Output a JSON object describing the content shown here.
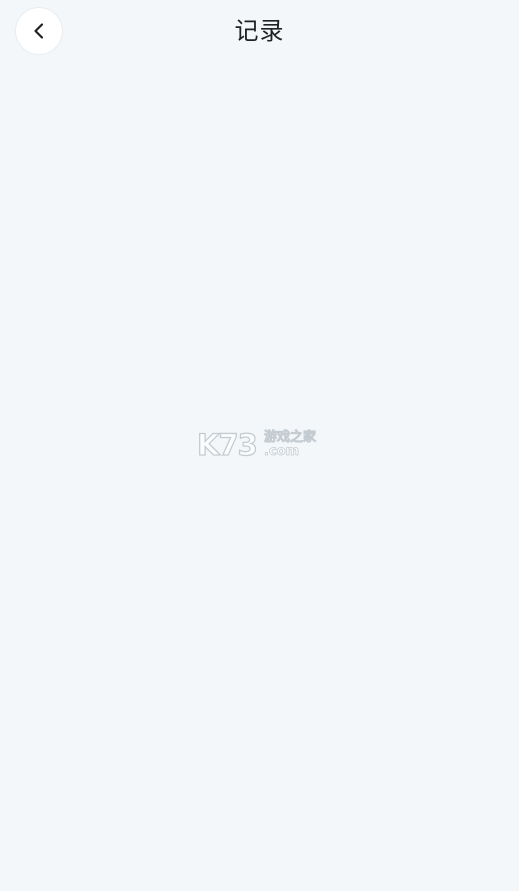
{
  "header": {
    "title": "记录",
    "back_icon": "chevron-left-icon"
  },
  "watermark": {
    "brand": "K73",
    "subtitle": "游戏之家",
    "domain": ".com"
  },
  "colors": {
    "background": "#f3f7fa",
    "header_button_bg": "#ffffff",
    "title_text": "#222222",
    "watermark_outline": "#b9c0c6"
  }
}
